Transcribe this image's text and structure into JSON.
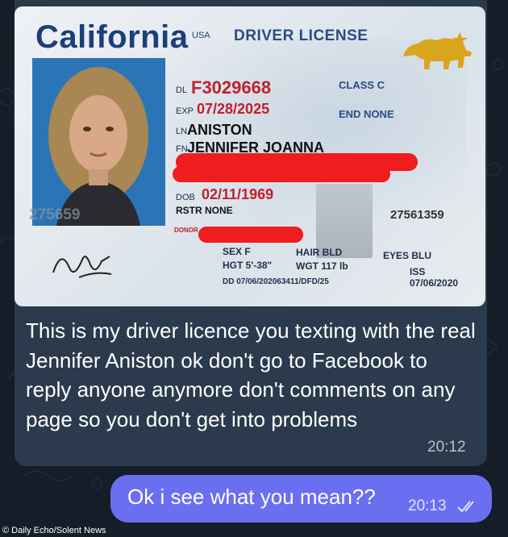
{
  "license": {
    "state": "California",
    "usa": "USA",
    "title": "DRIVER LICENSE",
    "dl_label": "DL",
    "dl_number": "F3029668",
    "class_label": "CLASS C",
    "exp_label": "EXP",
    "exp_date": "07/28/2025",
    "end_label": "END NONE",
    "ln_label": "LN",
    "last_name": "ANISTON",
    "fn_label": "FN",
    "first_name": "JENNIFER JOANNA",
    "dob_label": "DOB",
    "dob": "02/11/1969",
    "rstr": "RSTR NONE",
    "donor": "DONOR",
    "id_number": "27561359",
    "ghost_number": "275659",
    "sex": "SEX F",
    "hair": "HAIR BLD",
    "eyes": "EYES BLU",
    "height": "HGT 5'-38\"",
    "weight": "WGT 117 lb",
    "iss_label": "ISS",
    "iss_date": "07/06/2020",
    "dd": "DD 07/06/202063411/DFD/25"
  },
  "messages": {
    "incoming_text": "This is my driver licence you texting with the real Jennifer Aniston ok don't go to Facebook to reply anyone anymore don't comments on any page so you don't get into problems",
    "incoming_time": "20:12",
    "outgoing_text": "Ok i see what you mean??",
    "outgoing_time": "20:13"
  },
  "caption": "© Daily Echo/Solent News",
  "colors": {
    "background": "#151e28",
    "incoming_bubble": "#2b3a4c",
    "outgoing_bubble": "#6a6ff0",
    "redaction": "#ef1d1d"
  },
  "icons": [
    "bear-flag-icon",
    "double-check-icon"
  ]
}
